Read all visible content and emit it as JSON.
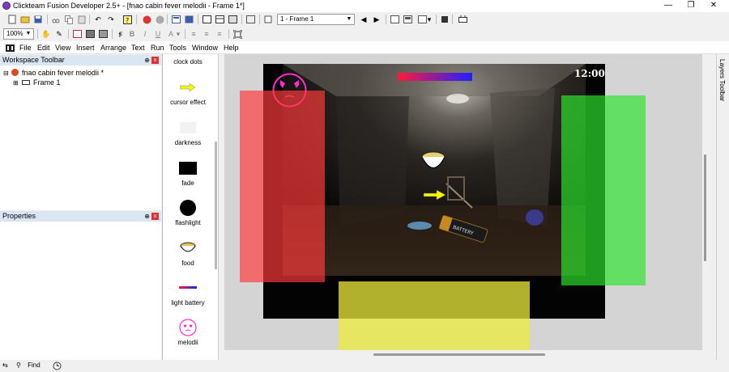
{
  "titlebar": {
    "title": "Clickteam Fusion Developer 2.5+ - [fnao cabin fever melodii - Frame 1*]",
    "minimize": "—",
    "restore": "❐",
    "close": "✕"
  },
  "toolbar": {
    "frame_select": "1 - Frame 1",
    "zoom": "100%"
  },
  "menu": {
    "items": [
      "File",
      "Edit",
      "View",
      "Insert",
      "Arrange",
      "Text",
      "Run",
      "Tools",
      "Window",
      "Help"
    ]
  },
  "workspace": {
    "title": "Workspace Toolbar",
    "application": "fnao cabin fever melodii *",
    "frame": "Frame 1"
  },
  "properties": {
    "title": "Properties"
  },
  "objects": [
    "clock dots",
    "cursor effect",
    "darkness",
    "fade",
    "flashlight",
    "food",
    "light battery",
    "melodii"
  ],
  "scene": {
    "clock": "12:00",
    "battery_label": "BATTERY"
  },
  "layers_toolbar": "Layers Toolbar",
  "statusbar": {
    "find": "Find"
  },
  "colors": {
    "red_zone": "#ff3b3b",
    "green_zone": "#2ee62e",
    "yellow_zone": "#ecec3c",
    "melodii_pink": "#ff2ad4"
  }
}
